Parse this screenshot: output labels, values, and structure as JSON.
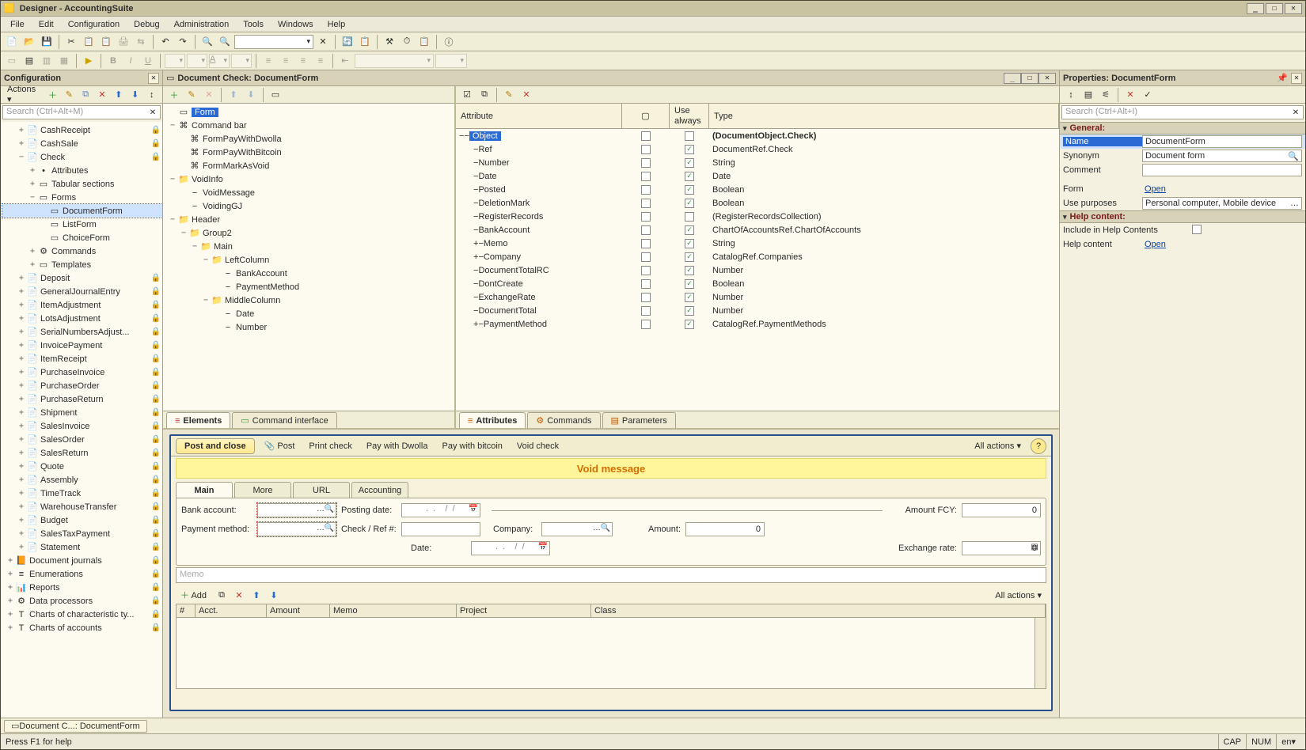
{
  "title": "Designer - AccountingSuite",
  "menus": [
    "File",
    "Edit",
    "Configuration",
    "Debug",
    "Administration",
    "Tools",
    "Windows",
    "Help"
  ],
  "left_panel": {
    "title": "Configuration",
    "actions_label": "Actions",
    "search_placeholder": "Search (Ctrl+Alt+M)",
    "tree": [
      {
        "d": 2,
        "t": "+",
        "i": "📄",
        "l": "CashReceipt",
        "lock": true
      },
      {
        "d": 2,
        "t": "+",
        "i": "📄",
        "l": "CashSale",
        "lock": true
      },
      {
        "d": 2,
        "t": "−",
        "i": "📄",
        "l": "Check",
        "lock": true
      },
      {
        "d": 3,
        "t": "+",
        "i": "•",
        "l": "Attributes"
      },
      {
        "d": 3,
        "t": "+",
        "i": "▭",
        "l": "Tabular sections"
      },
      {
        "d": 3,
        "t": "−",
        "i": "▭",
        "l": "Forms"
      },
      {
        "d": 4,
        "t": " ",
        "i": "▭",
        "l": "DocumentForm",
        "sel": true
      },
      {
        "d": 4,
        "t": " ",
        "i": "▭",
        "l": "ListForm"
      },
      {
        "d": 4,
        "t": " ",
        "i": "▭",
        "l": "ChoiceForm"
      },
      {
        "d": 3,
        "t": "+",
        "i": "⚙",
        "l": "Commands"
      },
      {
        "d": 3,
        "t": "+",
        "i": "▭",
        "l": "Templates"
      },
      {
        "d": 2,
        "t": "+",
        "i": "📄",
        "l": "Deposit",
        "lock": true
      },
      {
        "d": 2,
        "t": "+",
        "i": "📄",
        "l": "GeneralJournalEntry",
        "lock": true
      },
      {
        "d": 2,
        "t": "+",
        "i": "📄",
        "l": "ItemAdjustment",
        "lock": true
      },
      {
        "d": 2,
        "t": "+",
        "i": "📄",
        "l": "LotsAdjustment",
        "lock": true
      },
      {
        "d": 2,
        "t": "+",
        "i": "📄",
        "l": "SerialNumbersAdjust...",
        "lock": true
      },
      {
        "d": 2,
        "t": "+",
        "i": "📄",
        "l": "InvoicePayment",
        "lock": true
      },
      {
        "d": 2,
        "t": "+",
        "i": "📄",
        "l": "ItemReceipt",
        "lock": true
      },
      {
        "d": 2,
        "t": "+",
        "i": "📄",
        "l": "PurchaseInvoice",
        "lock": true
      },
      {
        "d": 2,
        "t": "+",
        "i": "📄",
        "l": "PurchaseOrder",
        "lock": true
      },
      {
        "d": 2,
        "t": "+",
        "i": "📄",
        "l": "PurchaseReturn",
        "lock": true
      },
      {
        "d": 2,
        "t": "+",
        "i": "📄",
        "l": "Shipment",
        "lock": true
      },
      {
        "d": 2,
        "t": "+",
        "i": "📄",
        "l": "SalesInvoice",
        "lock": true
      },
      {
        "d": 2,
        "t": "+",
        "i": "📄",
        "l": "SalesOrder",
        "lock": true
      },
      {
        "d": 2,
        "t": "+",
        "i": "📄",
        "l": "SalesReturn",
        "lock": true
      },
      {
        "d": 2,
        "t": "+",
        "i": "📄",
        "l": "Quote",
        "lock": true
      },
      {
        "d": 2,
        "t": "+",
        "i": "📄",
        "l": "Assembly",
        "lock": true
      },
      {
        "d": 2,
        "t": "+",
        "i": "📄",
        "l": "TimeTrack",
        "lock": true
      },
      {
        "d": 2,
        "t": "+",
        "i": "📄",
        "l": "WarehouseTransfer",
        "lock": true
      },
      {
        "d": 2,
        "t": "+",
        "i": "📄",
        "l": "Budget",
        "lock": true
      },
      {
        "d": 2,
        "t": "+",
        "i": "📄",
        "l": "SalesTaxPayment",
        "lock": true
      },
      {
        "d": 2,
        "t": "+",
        "i": "📄",
        "l": "Statement",
        "lock": true
      },
      {
        "d": 1,
        "t": "+",
        "i": "📙",
        "l": "Document journals",
        "lock": true
      },
      {
        "d": 1,
        "t": "+",
        "i": "≡",
        "l": "Enumerations",
        "lock": true
      },
      {
        "d": 1,
        "t": "+",
        "i": "📊",
        "l": "Reports",
        "lock": true
      },
      {
        "d": 1,
        "t": "+",
        "i": "⚙",
        "l": "Data processors",
        "lock": true
      },
      {
        "d": 1,
        "t": "+",
        "i": "T",
        "l": "Charts of characteristic ty...",
        "lock": true
      },
      {
        "d": 1,
        "t": "+",
        "i": "T",
        "l": "Charts of accounts",
        "lock": true
      }
    ]
  },
  "mdi": {
    "title": "Document Check: DocumentForm",
    "elements_tree": [
      {
        "d": 1,
        "t": " ",
        "i": "▭",
        "l": "Form",
        "sel": true
      },
      {
        "d": 1,
        "t": "−",
        "i": "⌘",
        "l": "Command bar"
      },
      {
        "d": 2,
        "t": " ",
        "i": "⌘",
        "l": "FormPayWithDwolla"
      },
      {
        "d": 2,
        "t": " ",
        "i": "⌘",
        "l": "FormPayWithBitcoin"
      },
      {
        "d": 2,
        "t": " ",
        "i": "⌘",
        "l": "FormMarkAsVoid"
      },
      {
        "d": 1,
        "t": "−",
        "i": "📁",
        "l": "VoidInfo"
      },
      {
        "d": 2,
        "t": " ",
        "i": "−",
        "l": "VoidMessage"
      },
      {
        "d": 2,
        "t": " ",
        "i": "−",
        "l": "VoidingGJ"
      },
      {
        "d": 1,
        "t": "−",
        "i": "📁",
        "l": "Header"
      },
      {
        "d": 2,
        "t": "−",
        "i": "📁",
        "l": "Group2"
      },
      {
        "d": 3,
        "t": "−",
        "i": "📁",
        "l": "Main"
      },
      {
        "d": 4,
        "t": "−",
        "i": "📁",
        "l": "LeftColumn"
      },
      {
        "d": 5,
        "t": " ",
        "i": "−",
        "l": "BankAccount"
      },
      {
        "d": 5,
        "t": " ",
        "i": "−",
        "l": "PaymentMethod"
      },
      {
        "d": 4,
        "t": "−",
        "i": "📁",
        "l": "MiddleColumn"
      },
      {
        "d": 5,
        "t": " ",
        "i": "−",
        "l": "Date"
      },
      {
        "d": 5,
        "t": " ",
        "i": "−",
        "l": "Number"
      }
    ],
    "tabs_left": [
      "Elements",
      "Command interface"
    ],
    "attr_cols": [
      "Attribute",
      "Use always",
      "Type"
    ],
    "attributes": [
      {
        "d": 1,
        "t": "−",
        "l": "Object",
        "use": false,
        "always": false,
        "type": "(DocumentObject.Check)",
        "bold": true,
        "hl": true
      },
      {
        "d": 2,
        "t": "",
        "l": "Ref",
        "use": false,
        "always": true,
        "type": "DocumentRef.Check"
      },
      {
        "d": 2,
        "t": "",
        "l": "Number",
        "use": false,
        "always": true,
        "type": "String"
      },
      {
        "d": 2,
        "t": "",
        "l": "Date",
        "use": false,
        "always": true,
        "type": "Date"
      },
      {
        "d": 2,
        "t": "",
        "l": "Posted",
        "use": false,
        "always": true,
        "type": "Boolean"
      },
      {
        "d": 2,
        "t": "",
        "l": "DeletionMark",
        "use": false,
        "always": true,
        "type": "Boolean"
      },
      {
        "d": 2,
        "t": "",
        "l": "RegisterRecords",
        "use": false,
        "always": false,
        "type": "(RegisterRecordsCollection)"
      },
      {
        "d": 2,
        "t": "",
        "l": "BankAccount",
        "use": false,
        "always": true,
        "type": "ChartOfAccountsRef.ChartOfAccounts"
      },
      {
        "d": 2,
        "t": "+",
        "l": "Memo",
        "use": false,
        "always": true,
        "type": "String"
      },
      {
        "d": 2,
        "t": "+",
        "l": "Company",
        "use": false,
        "always": true,
        "type": "CatalogRef.Companies"
      },
      {
        "d": 2,
        "t": "",
        "l": "DocumentTotalRC",
        "use": false,
        "always": true,
        "type": "Number"
      },
      {
        "d": 2,
        "t": "",
        "l": "DontCreate",
        "use": false,
        "always": true,
        "type": "Boolean"
      },
      {
        "d": 2,
        "t": "",
        "l": "ExchangeRate",
        "use": false,
        "always": true,
        "type": "Number"
      },
      {
        "d": 2,
        "t": "",
        "l": "DocumentTotal",
        "use": false,
        "always": true,
        "type": "Number"
      },
      {
        "d": 2,
        "t": "+",
        "l": "PaymentMethod",
        "use": false,
        "always": true,
        "type": "CatalogRef.PaymentMethods"
      }
    ],
    "tabs_right": [
      "Attributes",
      "Commands",
      "Parameters"
    ]
  },
  "preview": {
    "post_and_close": "Post and close",
    "toolbar": [
      "Post",
      "Print check",
      "Pay with Dwolla",
      "Pay with bitcoin",
      "Void check"
    ],
    "all_actions": "All actions",
    "void_msg": "Void message",
    "tabs": [
      "Main",
      "More",
      "URL",
      "Accounting"
    ],
    "fields": {
      "bank_account": "Bank account:",
      "payment_method": "Payment method:",
      "posting_date": "Posting date:",
      "check_ref": "Check / Ref #:",
      "date": "Date:",
      "company": "Company:",
      "amount_fcy": "Amount FCY:",
      "amount": "Amount:",
      "exchange_rate": "Exchange rate:",
      "date_placeholder": ".  .",
      "date_placeholder2": "/  /",
      "zero": "0"
    },
    "memo_placeholder": "Memo",
    "add": "Add",
    "table_cols": [
      "#",
      "Acct.",
      "Amount",
      "Memo",
      "Project",
      "Class"
    ]
  },
  "properties": {
    "title": "Properties: DocumentForm",
    "search_placeholder": "Search (Ctrl+Alt+I)",
    "general": "General:",
    "name_k": "Name",
    "name_v": "DocumentForm",
    "synonym_k": "Synonym",
    "synonym_v": "Document form",
    "comment_k": "Comment",
    "comment_v": "",
    "form_k": "Form",
    "form_v": "Open",
    "use_k": "Use purposes",
    "use_v": "Personal computer, Mobile device",
    "help": "Help content:",
    "inc_k": "Include in Help Contents",
    "helpc_k": "Help content",
    "helpc_v": "Open"
  },
  "taskbar": "Document C...: DocumentForm",
  "status": {
    "msg": "Press F1 for help",
    "cap": "CAP",
    "num": "NUM",
    "lang": "en"
  }
}
